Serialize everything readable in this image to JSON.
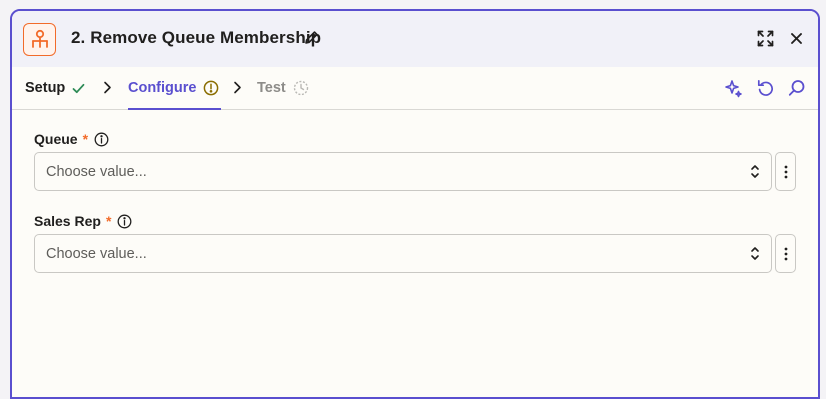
{
  "header": {
    "title": "2. Remove Queue Membership",
    "app_icon": "sitemap-icon",
    "actions": [
      "pencil-icon",
      "expand-icon",
      "close-icon"
    ]
  },
  "tabs": [
    {
      "label": "Setup",
      "status": "complete",
      "icon": "check-icon"
    },
    {
      "label": "Configure",
      "status": "warning",
      "icon": "alert-circle-icon",
      "active": true
    },
    {
      "label": "Test",
      "status": "pending",
      "icon": "progress-icon"
    }
  ],
  "toolbar": [
    "sparkle-icon",
    "undo-icon",
    "search-icon"
  ],
  "fields": [
    {
      "label": "Queue",
      "required_mark": "*",
      "placeholder": "Choose value..."
    },
    {
      "label": "Sales Rep",
      "required_mark": "*",
      "placeholder": "Choose value..."
    }
  ],
  "colors": {
    "accent": "#5a4fcf",
    "required": "#f26b2a",
    "success": "#2e8b57",
    "warning": "#8a6d00"
  }
}
